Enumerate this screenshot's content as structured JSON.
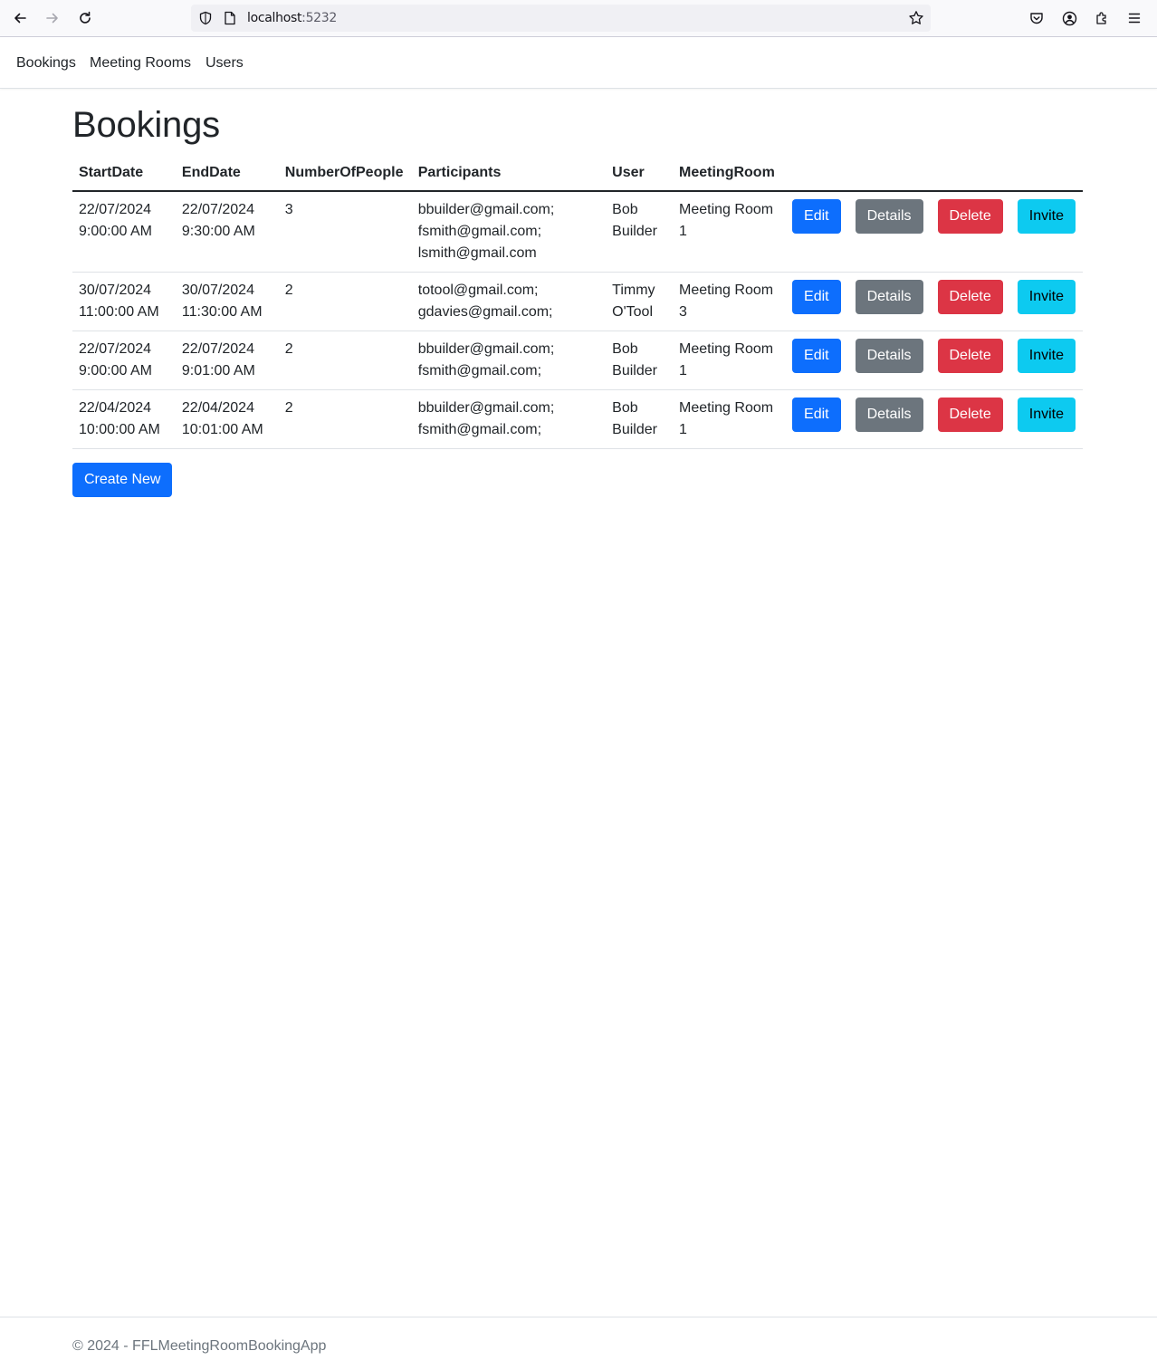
{
  "browser": {
    "url_host": "localhost",
    "url_port": ":5232"
  },
  "nav": {
    "items": [
      {
        "label": "Bookings"
      },
      {
        "label": "Meeting Rooms"
      },
      {
        "label": "Users"
      }
    ]
  },
  "page": {
    "title": "Bookings"
  },
  "table": {
    "headers": {
      "start": "StartDate",
      "end": "EndDate",
      "people": "NumberOfPeople",
      "participants": "Participants",
      "user": "User",
      "room": "MeetingRoom"
    },
    "rows": [
      {
        "start_date": "22/07/2024",
        "start_time": "9:00:00 AM",
        "end_date": "22/07/2024",
        "end_time": "9:30:00 AM",
        "people": "3",
        "participants": [
          "bbuilder@gmail.com;",
          "fsmith@gmail.com;",
          "lsmith@gmail.com"
        ],
        "user": "Bob Builder",
        "room": "Meeting Room 1"
      },
      {
        "start_date": "30/07/2024",
        "start_time": "11:00:00 AM",
        "end_date": "30/07/2024",
        "end_time": "11:30:00 AM",
        "people": "2",
        "participants": [
          "totool@gmail.com;",
          "gdavies@gmail.com;"
        ],
        "user": "Timmy O'Tool",
        "room": "Meeting Room 3"
      },
      {
        "start_date": "22/07/2024",
        "start_time": "9:00:00 AM",
        "end_date": "22/07/2024",
        "end_time": "9:01:00 AM",
        "people": "2",
        "participants": [
          "bbuilder@gmail.com;",
          "fsmith@gmail.com;"
        ],
        "user": "Bob Builder",
        "room": "Meeting Room 1"
      },
      {
        "start_date": "22/04/2024",
        "start_time": "10:00:00 AM",
        "end_date": "22/04/2024",
        "end_time": "10:01:00 AM",
        "people": "2",
        "participants": [
          "bbuilder@gmail.com;",
          "fsmith@gmail.com;"
        ],
        "user": "Bob Builder",
        "room": "Meeting Room 1"
      }
    ],
    "actions": {
      "edit": "Edit",
      "details": "Details",
      "delete": "Delete",
      "invite": "Invite"
    }
  },
  "create_new_label": "Create New",
  "footer": {
    "text": "© 2024 - FFLMeetingRoomBookingApp"
  },
  "colors": {
    "primary": "#0d6efd",
    "secondary": "#6c757d",
    "danger": "#dc3545",
    "info": "#0dcaf0"
  }
}
